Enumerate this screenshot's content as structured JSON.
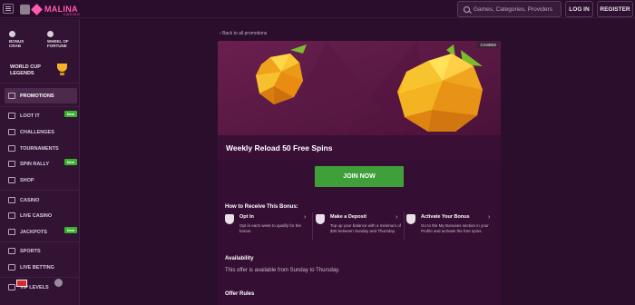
{
  "header": {
    "brand": "MALINA",
    "brand_sub": "CASINO",
    "search_placeholder": "Games, Categories, Providers",
    "login_label": "LOG IN",
    "register_label": "REGISTER"
  },
  "sidebar": {
    "quick_links": [
      {
        "label_line1": "BONUS",
        "label_line2": "CRAB",
        "icon": "crab-icon"
      },
      {
        "label_line1": "WHEEL OF",
        "label_line2": "FORTUNE",
        "icon": "wheel-icon"
      }
    ],
    "world_cup": {
      "line1": "WORLD CUP",
      "line2": "LEGENDS"
    },
    "items": [
      {
        "label": "PROMOTIONS",
        "icon": "gift-icon",
        "active": true
      },
      {
        "label": "LOOT IT",
        "icon": "chest-icon",
        "badge": "New"
      },
      {
        "label": "CHALLENGES",
        "icon": "target-icon"
      },
      {
        "label": "TOURNAMENTS",
        "icon": "trophy-icon"
      },
      {
        "label": "SPIN RALLY",
        "icon": "flag-icon",
        "badge": "New"
      },
      {
        "label": "SHOP",
        "icon": "cart-icon"
      },
      {
        "label": "CASINO",
        "icon": "cards-icon"
      },
      {
        "label": "LIVE CASINO",
        "icon": "chip-icon"
      },
      {
        "label": "JACKPOTS",
        "icon": "jackpot-icon",
        "badge": "New"
      },
      {
        "label": "SPORTS",
        "icon": "ball-icon"
      },
      {
        "label": "LIVE BETTING",
        "icon": "live-icon"
      },
      {
        "label": "VIP LEVELS",
        "icon": "crown-icon"
      }
    ]
  },
  "promo": {
    "back_link": "Back to all promotions",
    "tag": "CASINO",
    "title": "Weekly Reload 50 Free Spins",
    "cta": "JOIN NOW",
    "how_title": "How to Receive This Bonus:",
    "steps": [
      {
        "title": "Opt In",
        "desc": "Opt in each week to qualify for the bonus."
      },
      {
        "title": "Make a Deposit",
        "desc": "Top up your balance with a minimum of $30 between Sunday and Thursday."
      },
      {
        "title": "Activate Your Bonus",
        "desc": "Go to the My Bonuses section in your Profile and activate the free spins."
      }
    ],
    "availability_title": "Availability",
    "availability_text": "This offer is available from Sunday to Thursday.",
    "rules_title": "Offer Rules"
  },
  "colors": {
    "accent_pink": "#ff5cb2",
    "cta_green": "#3fa03a",
    "badge_green": "#3bb02e",
    "background": "#2a0e2b"
  }
}
